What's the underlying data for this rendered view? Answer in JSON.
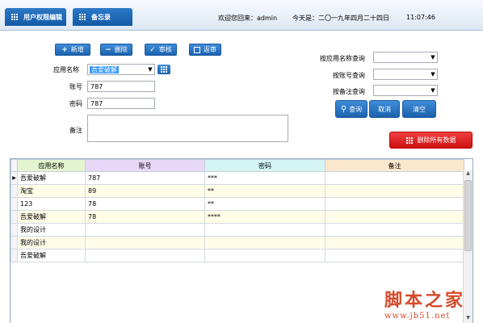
{
  "header": {
    "tabs": [
      {
        "label": "用户权限编辑"
      },
      {
        "label": "备忘录"
      }
    ],
    "welcome": "欢迎您回来：admin",
    "date": "今天是：二〇一九年四月二十四日",
    "time": "11:07:46"
  },
  "toolbar": {
    "add_label": "新增",
    "delete_label": "删除",
    "review_label": "审核",
    "unreview_label": "返审"
  },
  "form": {
    "app_name_label": "应用名称",
    "app_name_value": "吾爱破解",
    "account_label": "账号",
    "account_value": "787",
    "password_label": "密码",
    "password_value": "787",
    "remark_label": "备注",
    "remark_value": ""
  },
  "query": {
    "by_app_label": "按应用名称查询",
    "by_account_label": "按账号查询",
    "by_remark_label": "按备注查询",
    "query_label": "查询",
    "cancel_label": "取消",
    "clear_label": "清空",
    "delete_all_label": "删除所有数据"
  },
  "grid": {
    "columns": [
      "应用名称",
      "账号",
      "密码",
      "备注"
    ],
    "column_colors": [
      "#e2f5cf",
      "#e7d8f7",
      "#d5f4f4",
      "#fbe8cc"
    ],
    "rows": [
      [
        "吾爱破解",
        "787",
        "***",
        ""
      ],
      [
        "淘宝",
        "89",
        "**",
        ""
      ],
      [
        "123",
        "78",
        "**",
        ""
      ],
      [
        "吾爱破解",
        "78",
        "****",
        ""
      ],
      [
        "我的设计",
        "",
        "",
        ""
      ],
      [
        "我的设计",
        "",
        "",
        ""
      ],
      [
        "吾爱破解",
        "",
        "",
        ""
      ]
    ],
    "current_row_marker": "▶"
  },
  "watermark": {
    "line1": "脚本之家",
    "line2": "www.jb51.net"
  },
  "colors": {
    "accent": "#1b62ad",
    "danger": "#cc1010",
    "selection": "#3399ff"
  }
}
